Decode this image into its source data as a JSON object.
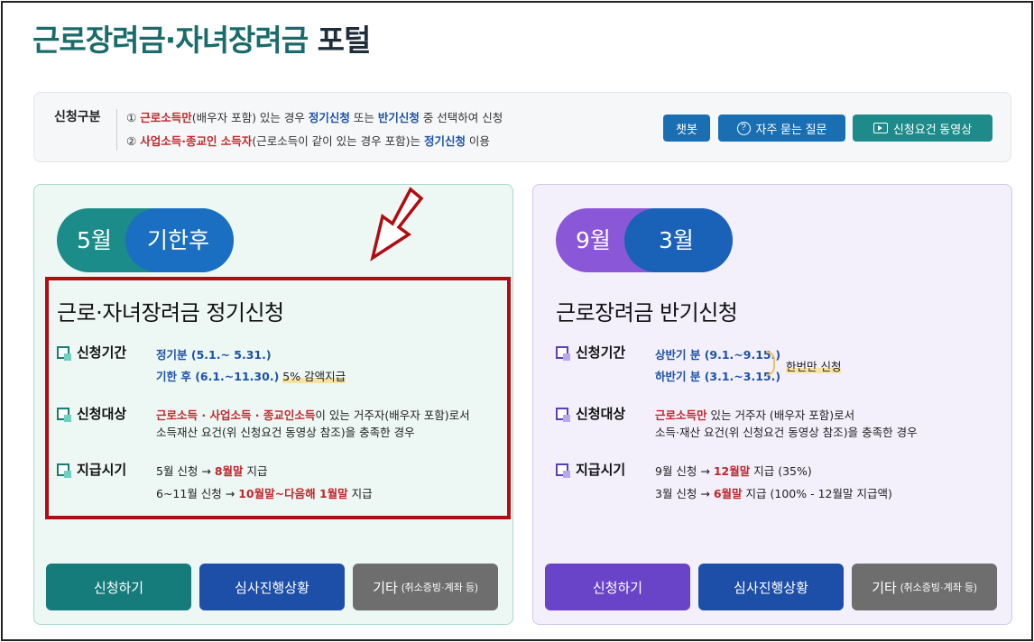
{
  "page": {
    "title_part1": "근로장려금·자녀장려금",
    "title_part2": "포털"
  },
  "info": {
    "label": "신청구분",
    "line1": {
      "num": "①",
      "red": "근로소득만",
      "t1": "(배우자 포함) 있는 경우 ",
      "blue1": "정기신청",
      "t2": " 또는 ",
      "blue2": "반기신청",
      "t3": " 중 선택하여 신청"
    },
    "line2": {
      "num": "②",
      "red": "사업소득·종교인 소득자",
      "t1": "(근로소득이 같이 있는 경우 포함)는 ",
      "blue1": "정기신청",
      "t2": " 이용"
    },
    "buttons": {
      "chat": "챗봇",
      "faq": "자주 묻는 질문",
      "video": "신청요건 동영상"
    }
  },
  "left_card": {
    "pill_a": "5월",
    "pill_b": "기한후",
    "title": "근로·자녀장려금 정기신청",
    "period_label": "신청기간",
    "period_line1": "정기분 (5.1.~ 5.31.)",
    "period_line2_blue": "기한 후 (6.1.~11.30.)",
    "period_line2_note": "5% 감액지급",
    "target_label": "신청대상",
    "target_red": "근로소득 · 사업소득 · 종교인소득",
    "target_rest": "이 있는 거주자(배우자 포함)로서",
    "target_line2": "소득재산 요건(위 신청요건 동영상 참조)을 충족한 경우",
    "pay_label": "지급시기",
    "pay1_pre": "5월 신청 → ",
    "pay1_red": "8월말",
    "pay1_post": " 지급",
    "pay2_pre": "6~11월 신청 → ",
    "pay2_red": "10월말~다음해 1월말",
    "pay2_post": " 지급",
    "btn_apply": "신청하기",
    "btn_status": "심사진행상황",
    "btn_etc": "기타",
    "btn_etc_small": "(취소증빙·계좌 등)"
  },
  "right_card": {
    "pill_a": "9월",
    "pill_b": "3월",
    "title": "근로장려금 반기신청",
    "period_label": "신청기간",
    "period_line1": "상반기 분 (9.1.~9.15.)",
    "period_line2": "하반기 분 (3.1.~3.15.)",
    "period_note": "한번만 신청",
    "target_label": "신청대상",
    "target_red": "근로소득만",
    "target_rest": " 있는 거주자 (배우자 포함)로서",
    "target_line2": "소득·재산 요건(위 신청요건 동영상 참조)을 충족한 경우",
    "pay_label": "지급시기",
    "pay1_pre": "9월 신청 → ",
    "pay1_red": "12월말",
    "pay1_post": " 지급 (35%)",
    "pay2_pre": "3월 신청 → ",
    "pay2_red": "6월말",
    "pay2_post": " 지급 (100% - 12월말 지급액)",
    "btn_apply": "신청하기",
    "btn_status": "심사진행상황",
    "btn_etc": "기타",
    "btn_etc_small": "(취소증빙·계좌 등)"
  },
  "colors": {
    "brand_teal": "#1a6b6b",
    "highlight_red": "#b00d12",
    "text_red": "#c0282d",
    "text_blue": "#1d52a8"
  }
}
